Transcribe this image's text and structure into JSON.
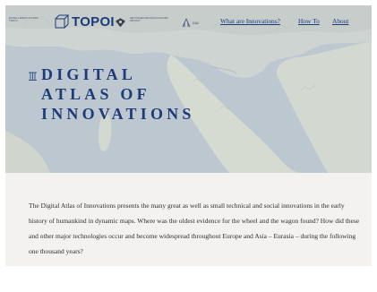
{
  "header": {
    "excellence_cluster": "Exzellenzcluster TOPOI",
    "topoi_logo": "TOPOI",
    "institute_text": "Deutsches Archäologisches Institut",
    "dai_logo": "DAI"
  },
  "nav": {
    "items": [
      {
        "label": "What are Innovations?"
      },
      {
        "label": "How To"
      },
      {
        "label": "About"
      }
    ]
  },
  "hero": {
    "title_lines": [
      "DIGITAL",
      "ATLAS OF",
      "INNOVATIONS"
    ]
  },
  "intro": {
    "text": "The Digital Atlas of Innovations presents the many great as well as small technical and social innovations in the early history of humankind in dynamic maps. Where was the oldest evidence for the wheel and the wagon found? How did these and other major technologies occur and become widespread throughout Europe and Asia – Eurasia – during the following one thousand years?"
  },
  "colors": {
    "brand": "#1c3b78",
    "sea": "#bcc6cf",
    "land": "#d8ddd2",
    "intro_bg": "#f3f2f0"
  }
}
